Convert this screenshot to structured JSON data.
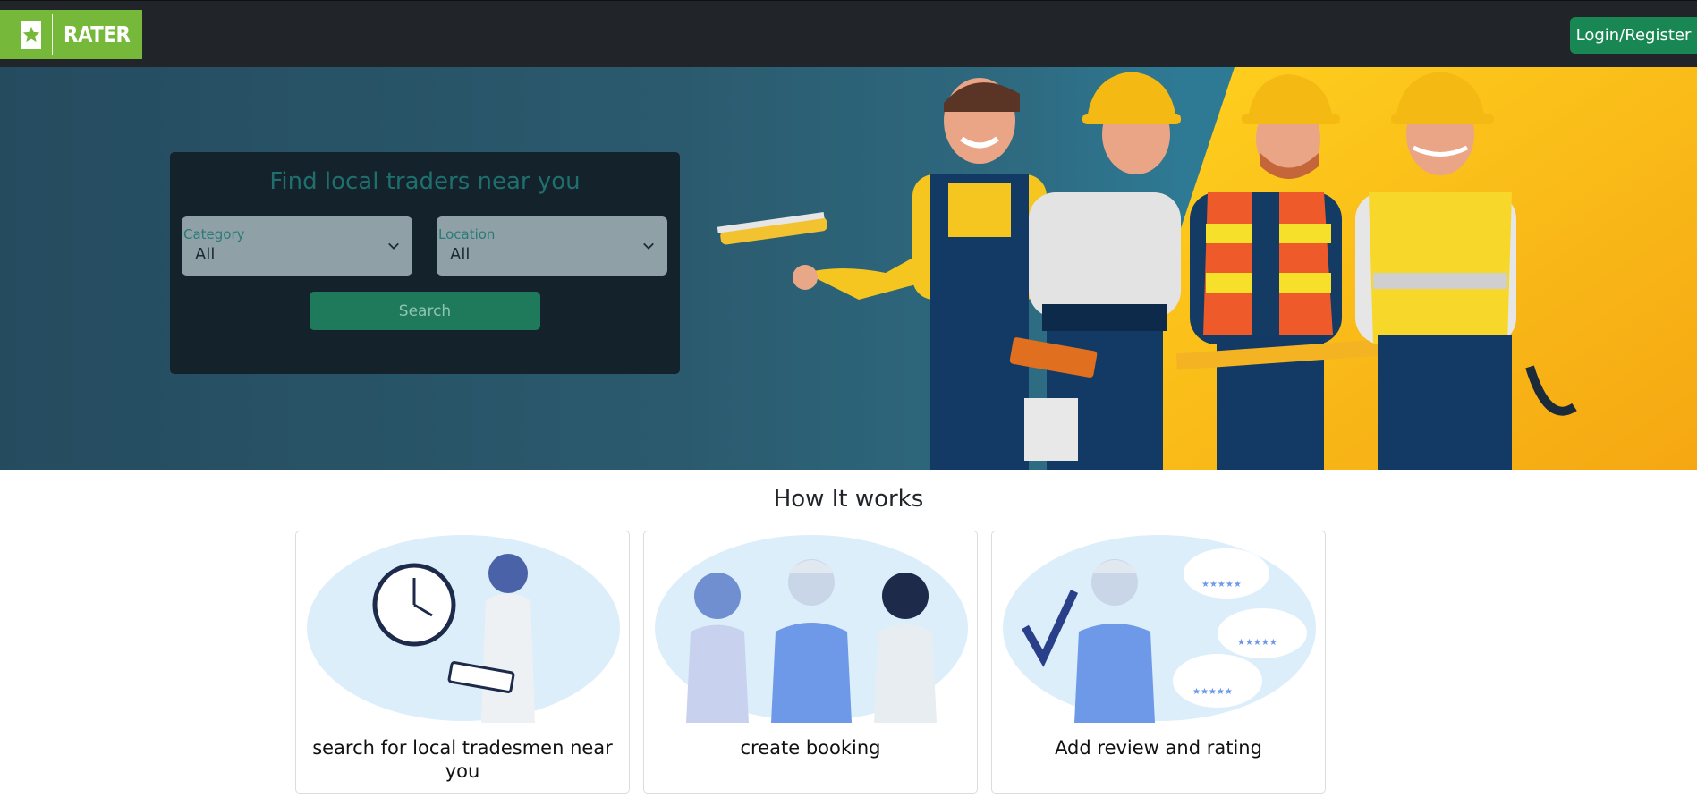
{
  "brand": {
    "name": "RATER",
    "icon": "star-icon",
    "color": "#76b83a"
  },
  "nav": {
    "login_label": "Login/Register"
  },
  "search": {
    "title": "Find local traders near you",
    "category": {
      "label": "Category",
      "value": "All"
    },
    "location": {
      "label": "Location",
      "value": "All"
    },
    "button_label": "Search"
  },
  "how_it_works": {
    "title": "How It works",
    "cards": [
      {
        "title": "search for local tradesmen near you",
        "image": "woman-with-clock-tablet-illustration"
      },
      {
        "title": "create booking",
        "image": "three-people-group-illustration"
      },
      {
        "title": "Add review and rating",
        "image": "worker-reviews-stars-illustration"
      }
    ]
  },
  "colors": {
    "navbar": "#212529",
    "accent_green": "#198754",
    "hero_yellow": "#f5b914"
  }
}
